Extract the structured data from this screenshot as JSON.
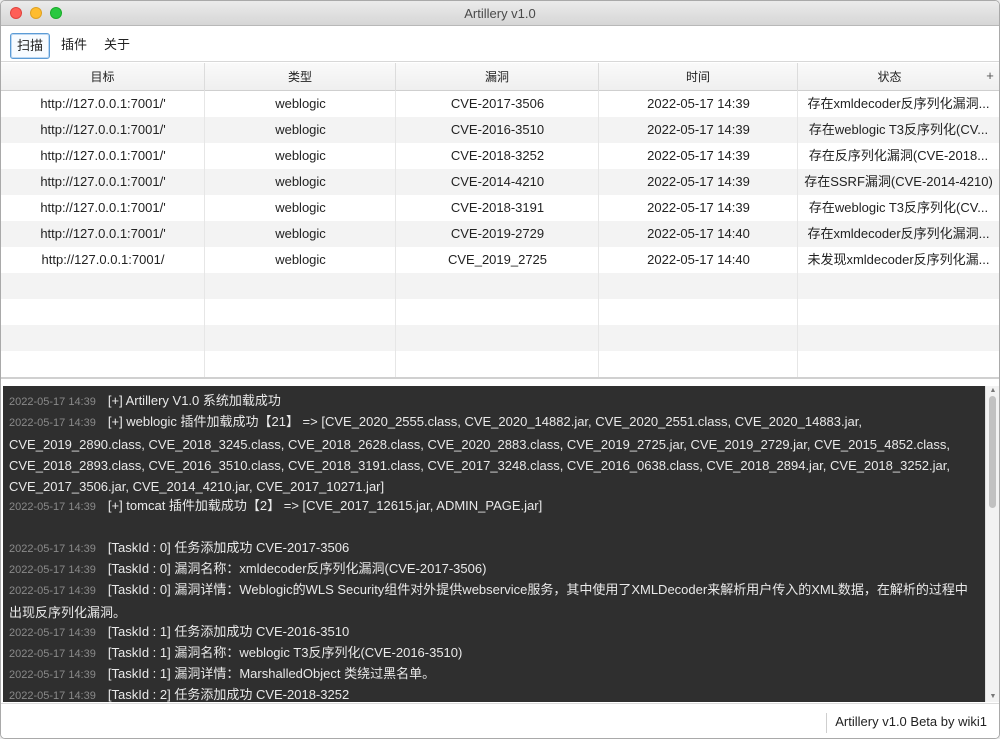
{
  "window": {
    "title": "Artillery v1.0"
  },
  "tabs": [
    {
      "label": "扫描",
      "active": true
    },
    {
      "label": "插件",
      "active": false
    },
    {
      "label": "关于",
      "active": false
    }
  ],
  "table": {
    "headers": [
      "目标",
      "类型",
      "漏洞",
      "时间",
      "状态"
    ],
    "add_column_glyph": "+",
    "rows": [
      {
        "target": "http://127.0.0.1:7001/'",
        "type": "weblogic",
        "vuln": "CVE-2017-3506",
        "time": "2022-05-17 14:39",
        "status": "存在xmldecoder反序列化漏洞..."
      },
      {
        "target": "http://127.0.0.1:7001/'",
        "type": "weblogic",
        "vuln": "CVE-2016-3510",
        "time": "2022-05-17 14:39",
        "status": "存在weblogic T3反序列化(CV..."
      },
      {
        "target": "http://127.0.0.1:7001/'",
        "type": "weblogic",
        "vuln": "CVE-2018-3252",
        "time": "2022-05-17 14:39",
        "status": "存在反序列化漏洞(CVE-2018..."
      },
      {
        "target": "http://127.0.0.1:7001/'",
        "type": "weblogic",
        "vuln": "CVE-2014-4210",
        "time": "2022-05-17 14:39",
        "status": "存在SSRF漏洞(CVE-2014-4210)"
      },
      {
        "target": "http://127.0.0.1:7001/'",
        "type": "weblogic",
        "vuln": "CVE-2018-3191",
        "time": "2022-05-17 14:39",
        "status": "存在weblogic T3反序列化(CV..."
      },
      {
        "target": "http://127.0.0.1:7001/'",
        "type": "weblogic",
        "vuln": "CVE-2019-2729",
        "time": "2022-05-17 14:40",
        "status": "存在xmldecoder反序列化漏洞..."
      },
      {
        "target": "http://127.0.0.1:7001/",
        "type": "weblogic",
        "vuln": "CVE_2019_2725",
        "time": "2022-05-17 14:40",
        "status": "未发现xmldecoder反序列化漏..."
      }
    ]
  },
  "log": {
    "lines": [
      {
        "ts": "2022-05-17 14:39",
        "text": "[+]   Artillery V1.0 系统加载成功"
      },
      {
        "ts": "2022-05-17 14:39",
        "text": "[+]   weblogic 插件加载成功【21】 => [CVE_2020_2555.class, CVE_2020_14882.jar, CVE_2020_2551.class, CVE_2020_14883.jar, CVE_2019_2890.class, CVE_2018_3245.class, CVE_2018_2628.class, CVE_2020_2883.class, CVE_2019_2725.jar, CVE_2019_2729.jar, CVE_2015_4852.class, CVE_2018_2893.class, CVE_2016_3510.class, CVE_2018_3191.class, CVE_2017_3248.class, CVE_2016_0638.class, CVE_2018_2894.jar, CVE_2018_3252.jar, CVE_2017_3506.jar, CVE_2014_4210.jar, CVE_2017_10271.jar]"
      },
      {
        "ts": "2022-05-17 14:39",
        "text": "[+]   tomcat 插件加载成功【2】 => [CVE_2017_12615.jar, ADMIN_PAGE.jar]"
      },
      {
        "ts": "",
        "text": ""
      },
      {
        "ts": "2022-05-17 14:39",
        "text": "[TaskId : 0] 任务添加成功 CVE-2017-3506"
      },
      {
        "ts": "2022-05-17 14:39",
        "text": "[TaskId : 0] 漏洞名称：xmldecoder反序列化漏洞(CVE-2017-3506)"
      },
      {
        "ts": "2022-05-17 14:39",
        "text": "[TaskId : 0] 漏洞详情：Weblogic的WLS Security组件对外提供webservice服务，其中使用了XMLDecoder来解析用户传入的XML数据，在解析的过程中出现反序列化漏洞。"
      },
      {
        "ts": "2022-05-17 14:39",
        "text": "[TaskId : 1] 任务添加成功 CVE-2016-3510"
      },
      {
        "ts": "2022-05-17 14:39",
        "text": "[TaskId : 1] 漏洞名称：weblogic T3反序列化(CVE-2016-3510)"
      },
      {
        "ts": "2022-05-17 14:39",
        "text": "[TaskId : 1] 漏洞详情：MarshalledObject 类绕过黑名单。"
      },
      {
        "ts": "2022-05-17 14:39",
        "text": "[TaskId : 2] 任务添加成功 CVE-2018-3252"
      }
    ]
  },
  "statusbar": {
    "text": "Artillery v1.0 Beta  by wiki1"
  }
}
